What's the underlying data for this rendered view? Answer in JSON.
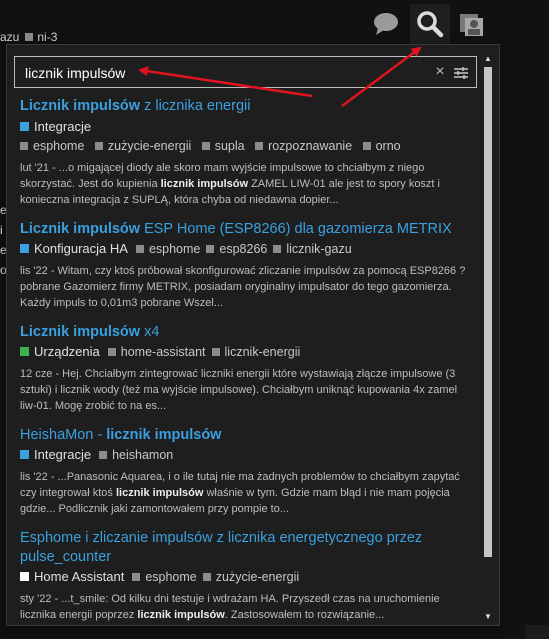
{
  "header": {
    "breadcrumb_left": "azu",
    "breadcrumb_tag": "ni-3",
    "icons": [
      "chat-icon",
      "search-icon",
      "user-menu-icon"
    ]
  },
  "search": {
    "value": "licznik impulsów",
    "clear_label": "×"
  },
  "results": [
    {
      "title_bold": "Licznik impulsów",
      "title_rest": " z licznika energii",
      "category": "Integracje",
      "category_color": "#3aa0e0",
      "tags": [
        "esphome",
        "zużycie-energii",
        "supla",
        "rozpoznawanie",
        "orno"
      ],
      "blurb_pre": "lut '21 - ...o migającej diody ale skoro mam wyjście impulsowe to chciałbym z niego skorzystać. Jest do kupienia ",
      "blurb_bold": "licznik impulsów",
      "blurb_post": " ZAMEL LIW-01 ale jest to spory koszt i konieczna integracja z SUPLĄ, która chyba od niedawna dopier..."
    },
    {
      "title_bold": "Licznik impulsów",
      "title_rest": " ESP Home (ESP8266) dla gazomierza METRIX",
      "category": "Konfiguracja HA",
      "category_color": "#3aa0e0",
      "tags": [
        "esphome",
        "esp8266",
        "licznik-gazu"
      ],
      "blurb_pre": "lis '22 - Witam, czy ktoś próbował skonfigurować zliczanie impulsów za pomocą ESP8266 ? pobrane Gazomierz firmy METRIX, posiadam oryginalny impulsator do tego gazomierza. Każdy impuls to 0,01m3 pobrane Wszel...",
      "blurb_bold": "",
      "blurb_post": ""
    },
    {
      "title_bold": "Licznik impulsów",
      "title_rest": " x4",
      "category": "Urządzenia",
      "category_color": "#3fb24f",
      "tags": [
        "home-assistant",
        "licznik-energii"
      ],
      "blurb_pre": "12 cze - Hej. Chciałbym zintegrować liczniki energii które wystawiają złącze impulsowe (3 sztuki) i licznik wody (też ma wyjście impulsowe). Chciałbym uniknąć kupowania 4x zamel liw-01. Mogę zrobić to na es...",
      "blurb_bold": "",
      "blurb_post": ""
    },
    {
      "title_plain": "HeishaMon - ",
      "title_bold": "licznik impulsów",
      "title_rest": "",
      "category": "Integracje",
      "category_color": "#3aa0e0",
      "tags": [
        "heishamon"
      ],
      "blurb_pre": "lis '22 - ...Panasonic Aquarea, i o ile tutaj nie ma żadnych problemów to chciałbym zapytać czy integrował ktoś ",
      "blurb_bold": "licznik impulsów",
      "blurb_post": " właśnie w tym. Gdzie mam błąd i nie mam pojęcia gdzie... Podlicznik jaki zamontowałem przy pompie to..."
    },
    {
      "title_plain": "Esphome i zliczanie impulsów z licznika energetycznego przez pulse_counter",
      "title_bold": "",
      "title_rest": "",
      "category": "Home Assistant",
      "category_color": "#ffffff",
      "tags": [
        "esphome",
        "zużycie-energii"
      ],
      "blurb_pre": "sty '22 - ...t_smile: Od kilku dni testuje i wdrażam HA. Przyszedł czas na uruchomienie licznika energii poprzez ",
      "blurb_bold": "licznik impulsów",
      "blurb_post": ". Zastosowałem to rozwiązanie..."
    }
  ],
  "background_text": [
    "e",
    "i",
    "es",
    "o"
  ]
}
